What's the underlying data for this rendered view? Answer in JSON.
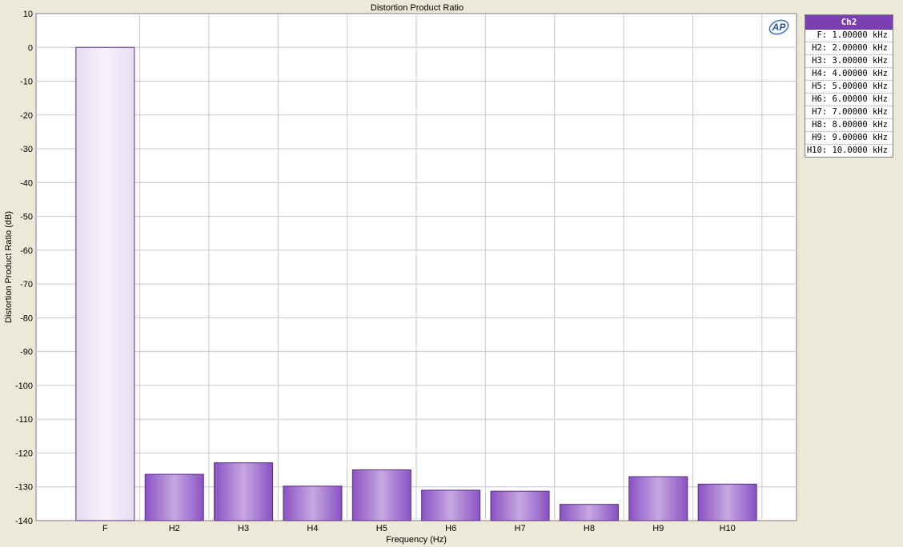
{
  "chart_data": {
    "type": "bar",
    "title": "Distortion Product Ratio",
    "xlabel": "Frequency (Hz)",
    "ylabel": "Distortion Product Ratio (dB)",
    "ylim": [
      -140,
      10
    ],
    "yticks": [
      "10",
      "0",
      "-10",
      "-20",
      "-30",
      "-40",
      "-50",
      "-60",
      "-70",
      "-80",
      "-90",
      "-100",
      "-110",
      "-120",
      "-130",
      "-140"
    ],
    "categories": [
      "F",
      "H2",
      "H3",
      "H4",
      "H5",
      "H6",
      "H7",
      "H8",
      "H9",
      "H10"
    ],
    "series": [
      {
        "name": "Ch2",
        "values": [
          0,
          -126.3,
          -122.9,
          -129.8,
          -125.0,
          -131.0,
          -131.3,
          -135.2,
          -127.0,
          -129.2
        ]
      }
    ],
    "grid": true,
    "legend_position": "right",
    "colors": {
      "bar": "#8a52c2",
      "bar_light": "#c6a8e2",
      "bar_border": "#5b2c8a",
      "legend_header": "#7b3fb4",
      "background": "#ece9d8",
      "plot": "#ffffff",
      "grid": "#c8c8c8"
    }
  },
  "legend": {
    "header": "Ch2",
    "items": [
      "F: 1.00000 kHz",
      "H2: 2.00000 kHz",
      "H3: 3.00000 kHz",
      "H4: 4.00000 kHz",
      "H5: 5.00000 kHz",
      "H6: 6.00000 kHz",
      "H7: 7.00000 kHz",
      "H8: 8.00000 kHz",
      "H9: 9.00000 kHz",
      "H10: 10.0000 kHz"
    ]
  },
  "logo": {
    "icon": "ap-logo-icon",
    "text": "AP"
  }
}
